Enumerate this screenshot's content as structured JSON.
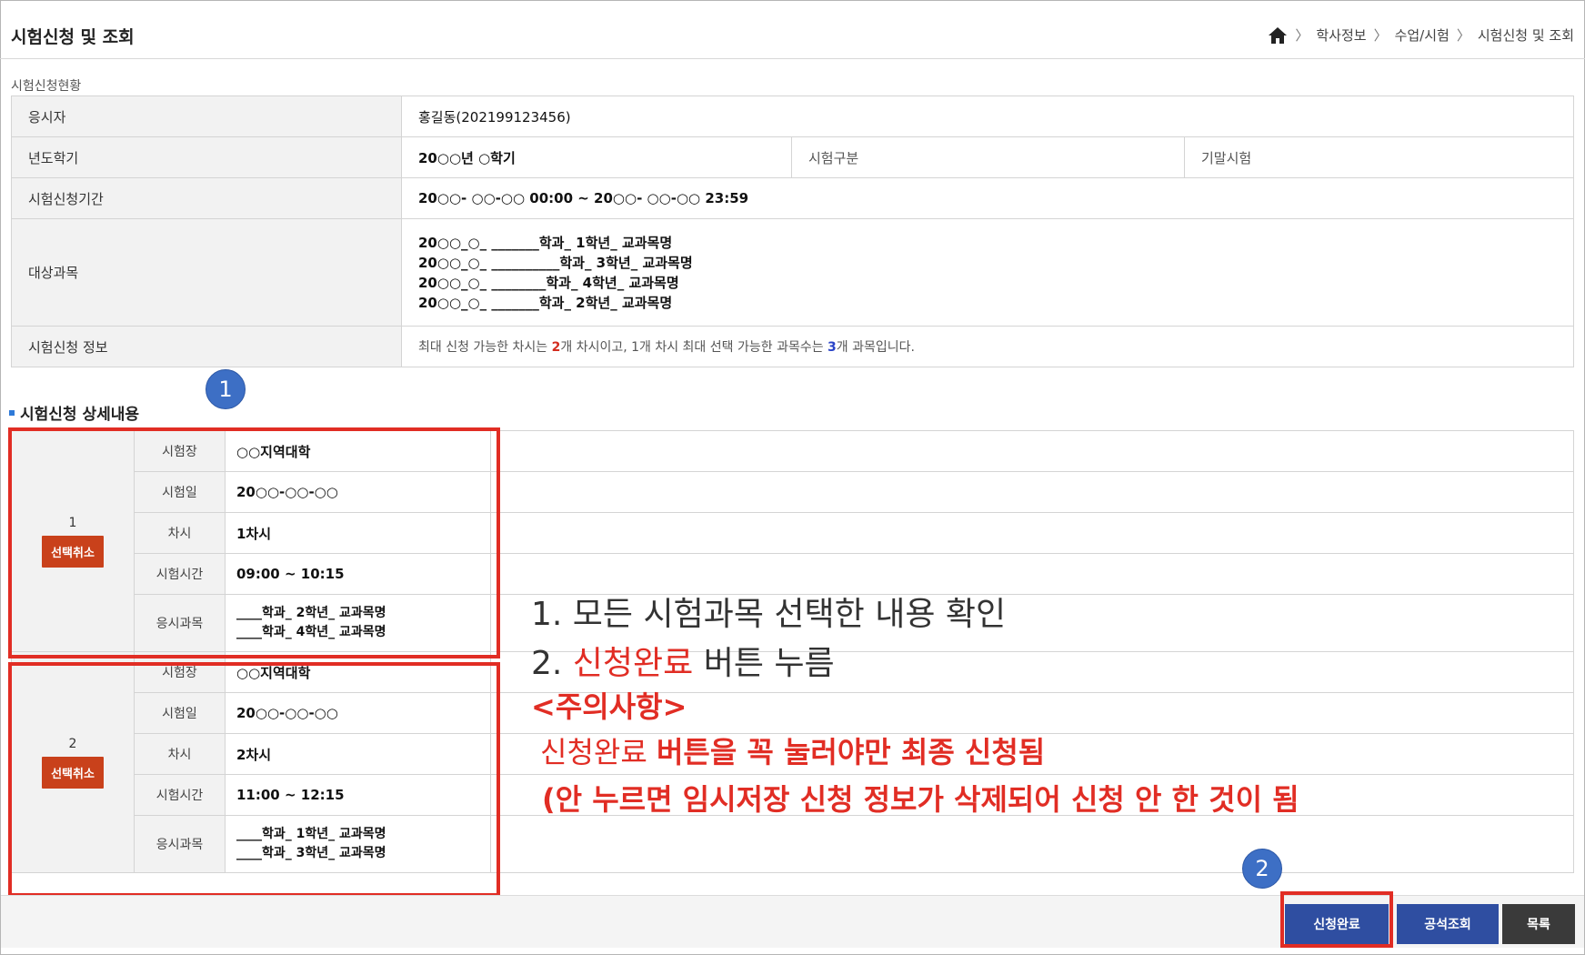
{
  "header": {
    "title": "시험신청 및 조회",
    "breadcrumb": [
      "학사정보",
      "수업/시험",
      "시험신청 및 조회"
    ]
  },
  "summary": {
    "section_label": "시험신청현황",
    "examinee_label": "응시자",
    "examinee_value": "홍길동(202199123456)",
    "term_label": "년도학기",
    "term_value": "20○○년 ○학기",
    "exam_type_label": "시험구분",
    "exam_type_value": "기말시험",
    "period_label": "시험신청기간",
    "period_value": "20○○- ○○-○○ 00:00 ~ 20○○- ○○-○○ 23:59",
    "courses_label": "대상과목",
    "courses": [
      "20○○_○_ _______학과_ 1학년_ 교과목명",
      "20○○_○_ __________학과_ 3학년_ 교과목명",
      "20○○_○_ ________학과_ 4학년_ 교과목명",
      "20○○_○_ _______학과_ 2학년_ 교과목명"
    ],
    "info_label": "시험신청 정보",
    "info_prefix": "최대 신청 가능한 차시는 ",
    "info_sessions": "2",
    "info_middle": "개 차시이고, 1개 차시 최대 선택 가능한 과목수는 ",
    "info_subjects": "3",
    "info_suffix": "개 과목입니다."
  },
  "detail": {
    "heading": "시험신청 상세내용",
    "labels": {
      "venue": "시험장",
      "date": "시험일",
      "session": "차시",
      "time": "시험시간",
      "subjects": "응시과목"
    },
    "cancel_label": "선택취소",
    "sessions": [
      {
        "number": "1",
        "venue": "○○지역대학",
        "date": "20○○-○○-○○",
        "session": "1차시",
        "time": "09:00 ~ 10:15",
        "subjects": [
          "____학과_ 2학년_ 교과목명",
          "____학과_ 4학년_ 교과목명"
        ]
      },
      {
        "number": "2",
        "venue": "○○지역대학",
        "date": "20○○-○○-○○",
        "session": "2차시",
        "time": "11:00 ~ 12:15",
        "subjects": [
          "____학과_ 1학년_ 교과목명",
          "____학과_ 3학년_ 교과목명"
        ]
      }
    ]
  },
  "annotations": {
    "badge1": "1",
    "badge2": "2",
    "step1": "1.  모든 시험과목 선택한 내용 확인",
    "step2_prefix": "2.  ",
    "step2_red": "신청완료",
    "step2_suffix": " 버튼 누름",
    "caution": "<주의사항>",
    "must_prefix": "신청완료 ",
    "must_bold": "버튼을 꼭 눌러야만 최종 신청됨",
    "warning": "(안 누르면 임시저장 신청 정보가 삭제되어 신청 안 한 것이 됨"
  },
  "buttons": {
    "complete": "신청완료",
    "grades": "공석조회",
    "list": "목록"
  },
  "colors": {
    "highlight_red": "#e12d24",
    "badge_blue": "#3d6fc5",
    "button_blue": "#2f4ea1",
    "cancel_orange": "#c9411b"
  }
}
